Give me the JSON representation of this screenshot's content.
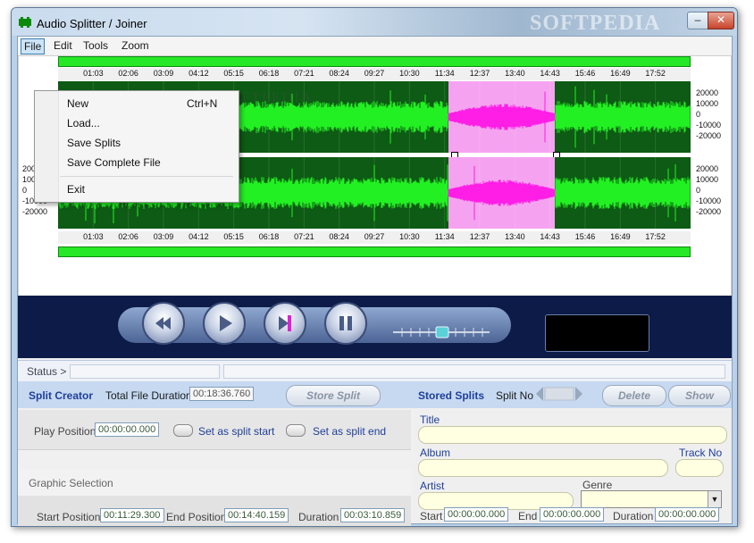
{
  "window": {
    "title": "Audio Splitter / Joiner",
    "watermark": "SOFTPEDIA",
    "minimize": "–",
    "close": "✕"
  },
  "menubar": {
    "file": "File",
    "edit": "Edit",
    "tools": "Tools",
    "zoom": "Zoom"
  },
  "file_menu": {
    "new": "New",
    "new_shortcut": "Ctrl+N",
    "load": "Load...",
    "save_splits": "Save Splits",
    "save_complete": "Save Complete File",
    "exit": "Exit"
  },
  "timeline": {
    "ticks": [
      "01:03",
      "02:06",
      "03:09",
      "04:12",
      "05:15",
      "06:18",
      "07:21",
      "08:24",
      "09:27",
      "10:30",
      "11:34",
      "12:37",
      "13:40",
      "14:43",
      "15:46",
      "16:49",
      "17:52"
    ],
    "amplitude_labels": [
      "20000",
      "10000",
      "0",
      "-10000",
      "-20000"
    ],
    "selection_start_fraction": 0.617,
    "selection_end_fraction": 0.786
  },
  "colors": {
    "wave": "#22f022",
    "wave_bg": "#0d5b14",
    "selection": "#f5a3f0",
    "selection_wave": "#ff1ee6",
    "accent": "#1f3f9b"
  },
  "status": {
    "label": "Status >"
  },
  "split_creator": {
    "title": "Split Creator",
    "total_duration_label": "Total File Duration",
    "total_duration": "00:18:36.760",
    "store_split": "Store Split",
    "play_position_label": "Play Position",
    "play_position": "00:00:00.000",
    "set_start": "Set as split start",
    "set_end": "Set as split end",
    "graphic_selection": "Graphic Selection",
    "start_position_label": "Start Position",
    "start_position": "00:11:29.300",
    "end_position_label": "End Position",
    "end_position": "00:14:40.159",
    "duration_label": "Duration",
    "duration": "00:03:10.859"
  },
  "stored_splits": {
    "title": "Stored Splits",
    "split_no_label": "Split No",
    "delete": "Delete",
    "show": "Show",
    "title_label": "Title",
    "album_label": "Album",
    "track_no_label": "Track No",
    "artist_label": "Artist",
    "genre_label": "Genre",
    "start_label": "Start",
    "start": "00:00:00.000",
    "end_label": "End",
    "end": "00:00:00.000",
    "duration_label": "Duration",
    "duration": "00:00:00.000"
  }
}
